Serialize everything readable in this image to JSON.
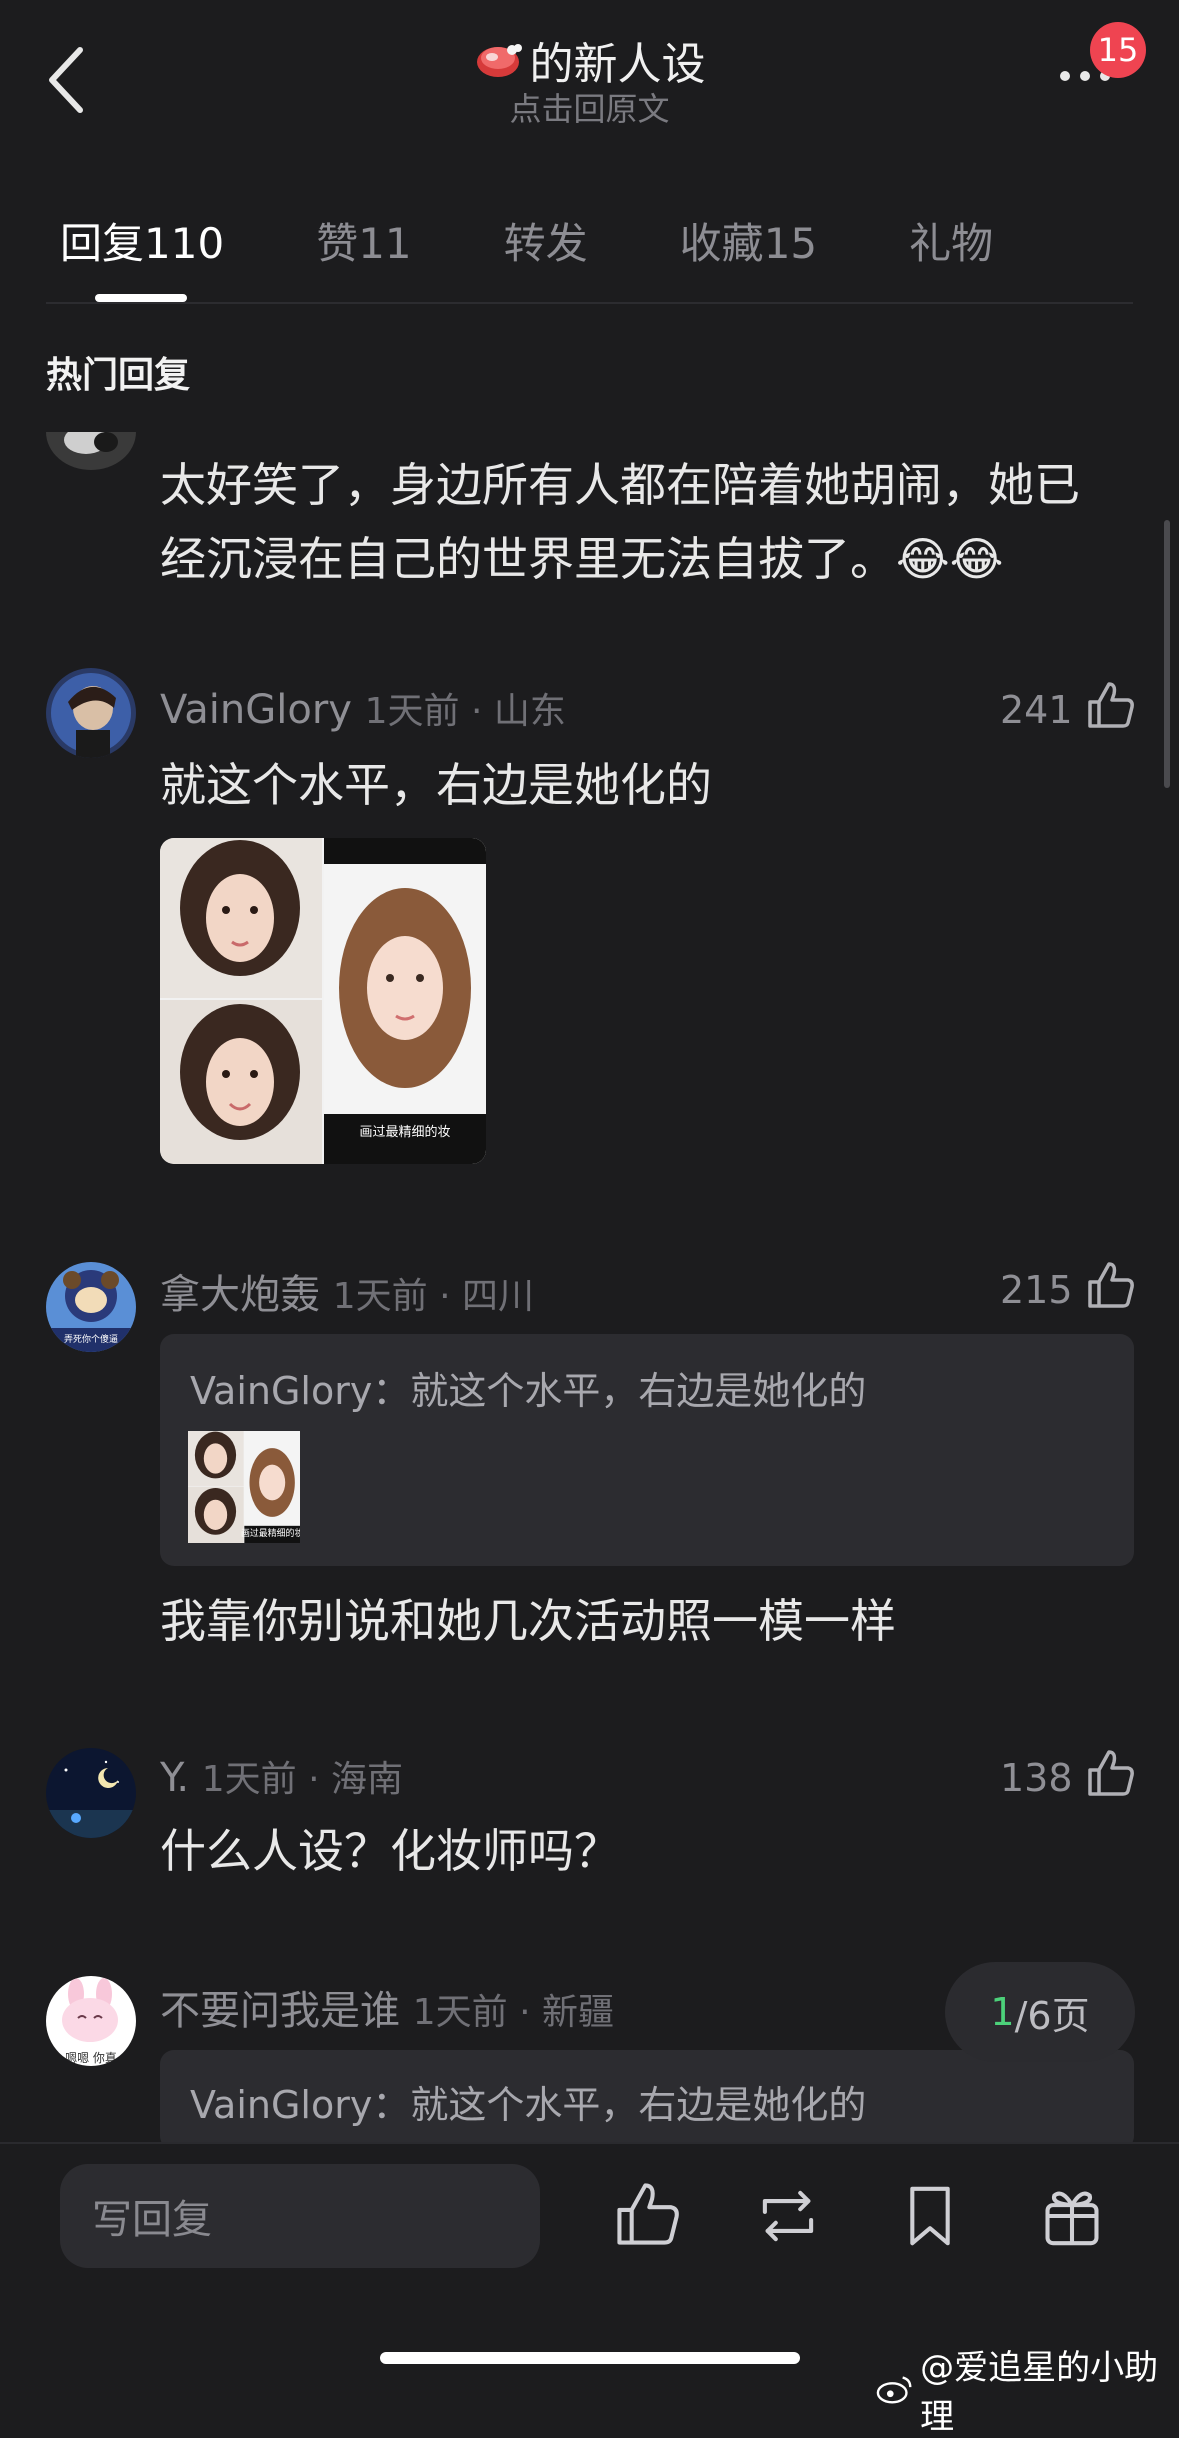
{
  "header": {
    "title": "的新人设",
    "subtitle": "点击回原文",
    "badge_count": "15",
    "title_icon": "meat-icon"
  },
  "tabs": [
    {
      "label": "回复",
      "count": "110",
      "active": true
    },
    {
      "label": "赞",
      "count": "11",
      "active": false
    },
    {
      "label": "转发",
      "count": "",
      "active": false
    },
    {
      "label": "收藏",
      "count": "15",
      "active": false
    },
    {
      "label": "礼物",
      "count": "",
      "active": false
    }
  ],
  "section_title": "热门回复",
  "comments": [
    {
      "text": "太好笑了，身边所有人都在陪着她胡闹，她已经沉浸在自己的世界里无法自拔了。😂😂"
    },
    {
      "name": "VainGlory",
      "meta": "1天前 · 山东",
      "likes": "241",
      "text": "就这个水平，右边是她化的",
      "image_caption": "画过最精细的妆"
    },
    {
      "name": "拿大炮轰",
      "meta": "1天前 · 四川",
      "likes": "215",
      "avatar_caption": "弄死你个傻逼",
      "quote": "VainGlory：就这个水平，右边是她化的",
      "quote_image_caption": "画过最精细的妆",
      "text": "我靠你别说和她几次活动照一模一样"
    },
    {
      "name": "Y.",
      "meta": "1天前 · 海南",
      "likes": "138",
      "text": "什么人设？化妆师吗？"
    },
    {
      "name": "不要问我是谁",
      "meta": "1天前 · 新疆",
      "avatar_caption": "嗯嗯 你真",
      "quote": "VainGlory：就这个水平，右边是她化的"
    }
  ],
  "pager": {
    "current": "1",
    "total_suffix": "/6页"
  },
  "bottom_bar": {
    "reply_placeholder": "写回复",
    "icons": [
      "like-icon",
      "repost-icon",
      "bookmark-icon",
      "gift-icon"
    ]
  },
  "watermark": "@爱追星的小助理",
  "colors": {
    "background": "#1c1c1e",
    "badge": "#ef4451",
    "pager_current": "#4cd17a"
  }
}
